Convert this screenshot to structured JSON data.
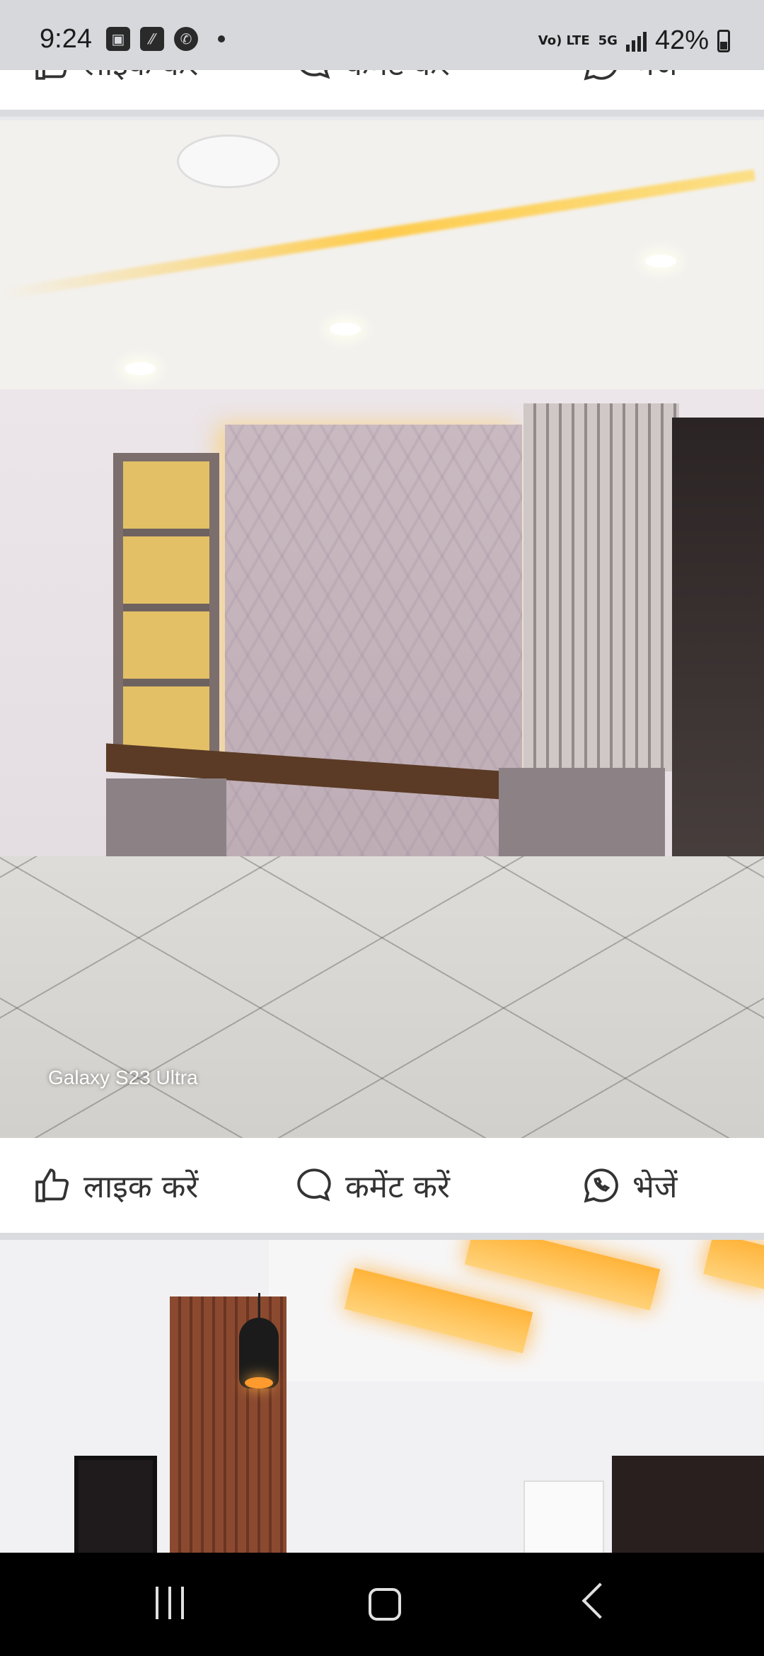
{
  "status_bar": {
    "time": "9:24",
    "network": "5G",
    "volte": "Vo) LTE",
    "battery": "42%"
  },
  "post_actions": {
    "like_label": "लाइक करें",
    "comment_label": "कमेंट करें",
    "share_label": "भेजें"
  },
  "photo1": {
    "watermark": "Galaxy S23 Ultra"
  },
  "icons": {
    "like": "thumbs-up-icon",
    "comment": "comment-bubble-icon",
    "share": "whatsapp-icon"
  },
  "colors": {
    "status_bar_bg": "#d6d8dc",
    "action_bar_bg": "#ffffff",
    "nav_bar_bg": "#000000",
    "text": "#333333"
  }
}
